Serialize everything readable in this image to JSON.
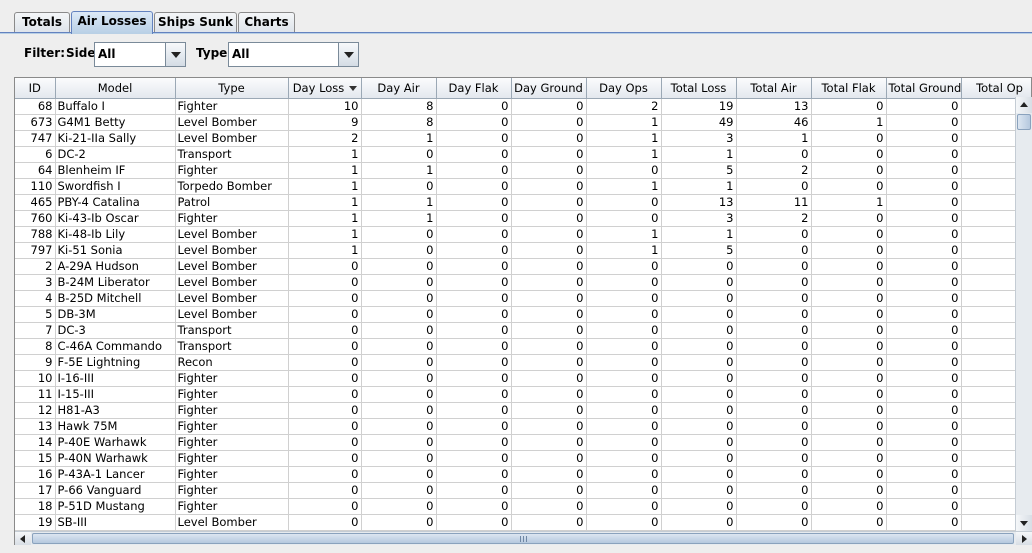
{
  "tabs": [
    {
      "label": "Totals"
    },
    {
      "label": "Air Losses",
      "active": true
    },
    {
      "label": "Ships Sunk"
    },
    {
      "label": "Charts"
    }
  ],
  "filter": {
    "label": "Filter:",
    "side_label": "Side:",
    "side_value": "All",
    "type_label": "Type:",
    "type_value": "All"
  },
  "table": {
    "sorted_column": "Day Loss",
    "columns": [
      "ID",
      "Model",
      "Type",
      "Day Loss",
      "Day Air",
      "Day Flak",
      "Day Ground",
      "Day Ops",
      "Total Loss",
      "Total Air",
      "Total Flak",
      "Total Ground",
      "Total Op"
    ],
    "rows": [
      [
        "68",
        "Buffalo I",
        "Fighter",
        "10",
        "8",
        "0",
        "0",
        "2",
        "19",
        "13",
        "0",
        "0"
      ],
      [
        "673",
        "G4M1 Betty",
        "Level Bomber",
        "9",
        "8",
        "0",
        "0",
        "1",
        "49",
        "46",
        "1",
        "0"
      ],
      [
        "747",
        "Ki-21-IIa Sally",
        "Level Bomber",
        "2",
        "1",
        "0",
        "0",
        "1",
        "3",
        "1",
        "0",
        "0"
      ],
      [
        "6",
        "DC-2",
        "Transport",
        "1",
        "0",
        "0",
        "0",
        "1",
        "1",
        "0",
        "0",
        "0"
      ],
      [
        "64",
        "Blenheim IF",
        "Fighter",
        "1",
        "1",
        "0",
        "0",
        "0",
        "5",
        "2",
        "0",
        "0"
      ],
      [
        "110",
        "Swordfish I",
        "Torpedo Bomber",
        "1",
        "0",
        "0",
        "0",
        "1",
        "1",
        "0",
        "0",
        "0"
      ],
      [
        "465",
        "PBY-4 Catalina",
        "Patrol",
        "1",
        "1",
        "0",
        "0",
        "0",
        "13",
        "11",
        "1",
        "0"
      ],
      [
        "760",
        "Ki-43-Ib Oscar",
        "Fighter",
        "1",
        "1",
        "0",
        "0",
        "0",
        "3",
        "2",
        "0",
        "0"
      ],
      [
        "788",
        "Ki-48-Ib Lily",
        "Level Bomber",
        "1",
        "0",
        "0",
        "0",
        "1",
        "1",
        "0",
        "0",
        "0"
      ],
      [
        "797",
        "Ki-51 Sonia",
        "Level Bomber",
        "1",
        "0",
        "0",
        "0",
        "1",
        "5",
        "0",
        "0",
        "0"
      ],
      [
        "2",
        "A-29A Hudson",
        "Level Bomber",
        "0",
        "0",
        "0",
        "0",
        "0",
        "0",
        "0",
        "0",
        "0"
      ],
      [
        "3",
        "B-24M Liberator",
        "Level Bomber",
        "0",
        "0",
        "0",
        "0",
        "0",
        "0",
        "0",
        "0",
        "0"
      ],
      [
        "4",
        "B-25D Mitchell",
        "Level Bomber",
        "0",
        "0",
        "0",
        "0",
        "0",
        "0",
        "0",
        "0",
        "0"
      ],
      [
        "5",
        "DB-3M",
        "Level Bomber",
        "0",
        "0",
        "0",
        "0",
        "0",
        "0",
        "0",
        "0",
        "0"
      ],
      [
        "7",
        "DC-3",
        "Transport",
        "0",
        "0",
        "0",
        "0",
        "0",
        "0",
        "0",
        "0",
        "0"
      ],
      [
        "8",
        "C-46A Commando",
        "Transport",
        "0",
        "0",
        "0",
        "0",
        "0",
        "0",
        "0",
        "0",
        "0"
      ],
      [
        "9",
        "F-5E Lightning",
        "Recon",
        "0",
        "0",
        "0",
        "0",
        "0",
        "0",
        "0",
        "0",
        "0"
      ],
      [
        "10",
        "I-16-III",
        "Fighter",
        "0",
        "0",
        "0",
        "0",
        "0",
        "0",
        "0",
        "0",
        "0"
      ],
      [
        "11",
        "I-15-III",
        "Fighter",
        "0",
        "0",
        "0",
        "0",
        "0",
        "0",
        "0",
        "0",
        "0"
      ],
      [
        "12",
        "H81-A3",
        "Fighter",
        "0",
        "0",
        "0",
        "0",
        "0",
        "0",
        "0",
        "0",
        "0"
      ],
      [
        "13",
        "Hawk 75M",
        "Fighter",
        "0",
        "0",
        "0",
        "0",
        "0",
        "0",
        "0",
        "0",
        "0"
      ],
      [
        "14",
        "P-40E Warhawk",
        "Fighter",
        "0",
        "0",
        "0",
        "0",
        "0",
        "0",
        "0",
        "0",
        "0"
      ],
      [
        "15",
        "P-40N Warhawk",
        "Fighter",
        "0",
        "0",
        "0",
        "0",
        "0",
        "0",
        "0",
        "0",
        "0"
      ],
      [
        "16",
        "P-43A-1 Lancer",
        "Fighter",
        "0",
        "0",
        "0",
        "0",
        "0",
        "0",
        "0",
        "0",
        "0"
      ],
      [
        "17",
        "P-66 Vanguard",
        "Fighter",
        "0",
        "0",
        "0",
        "0",
        "0",
        "0",
        "0",
        "0",
        "0"
      ],
      [
        "18",
        "P-51D Mustang",
        "Fighter",
        "0",
        "0",
        "0",
        "0",
        "0",
        "0",
        "0",
        "0",
        "0"
      ],
      [
        "19",
        "SB-III",
        "Level Bomber",
        "0",
        "0",
        "0",
        "0",
        "0",
        "0",
        "0",
        "0",
        "0"
      ]
    ]
  }
}
